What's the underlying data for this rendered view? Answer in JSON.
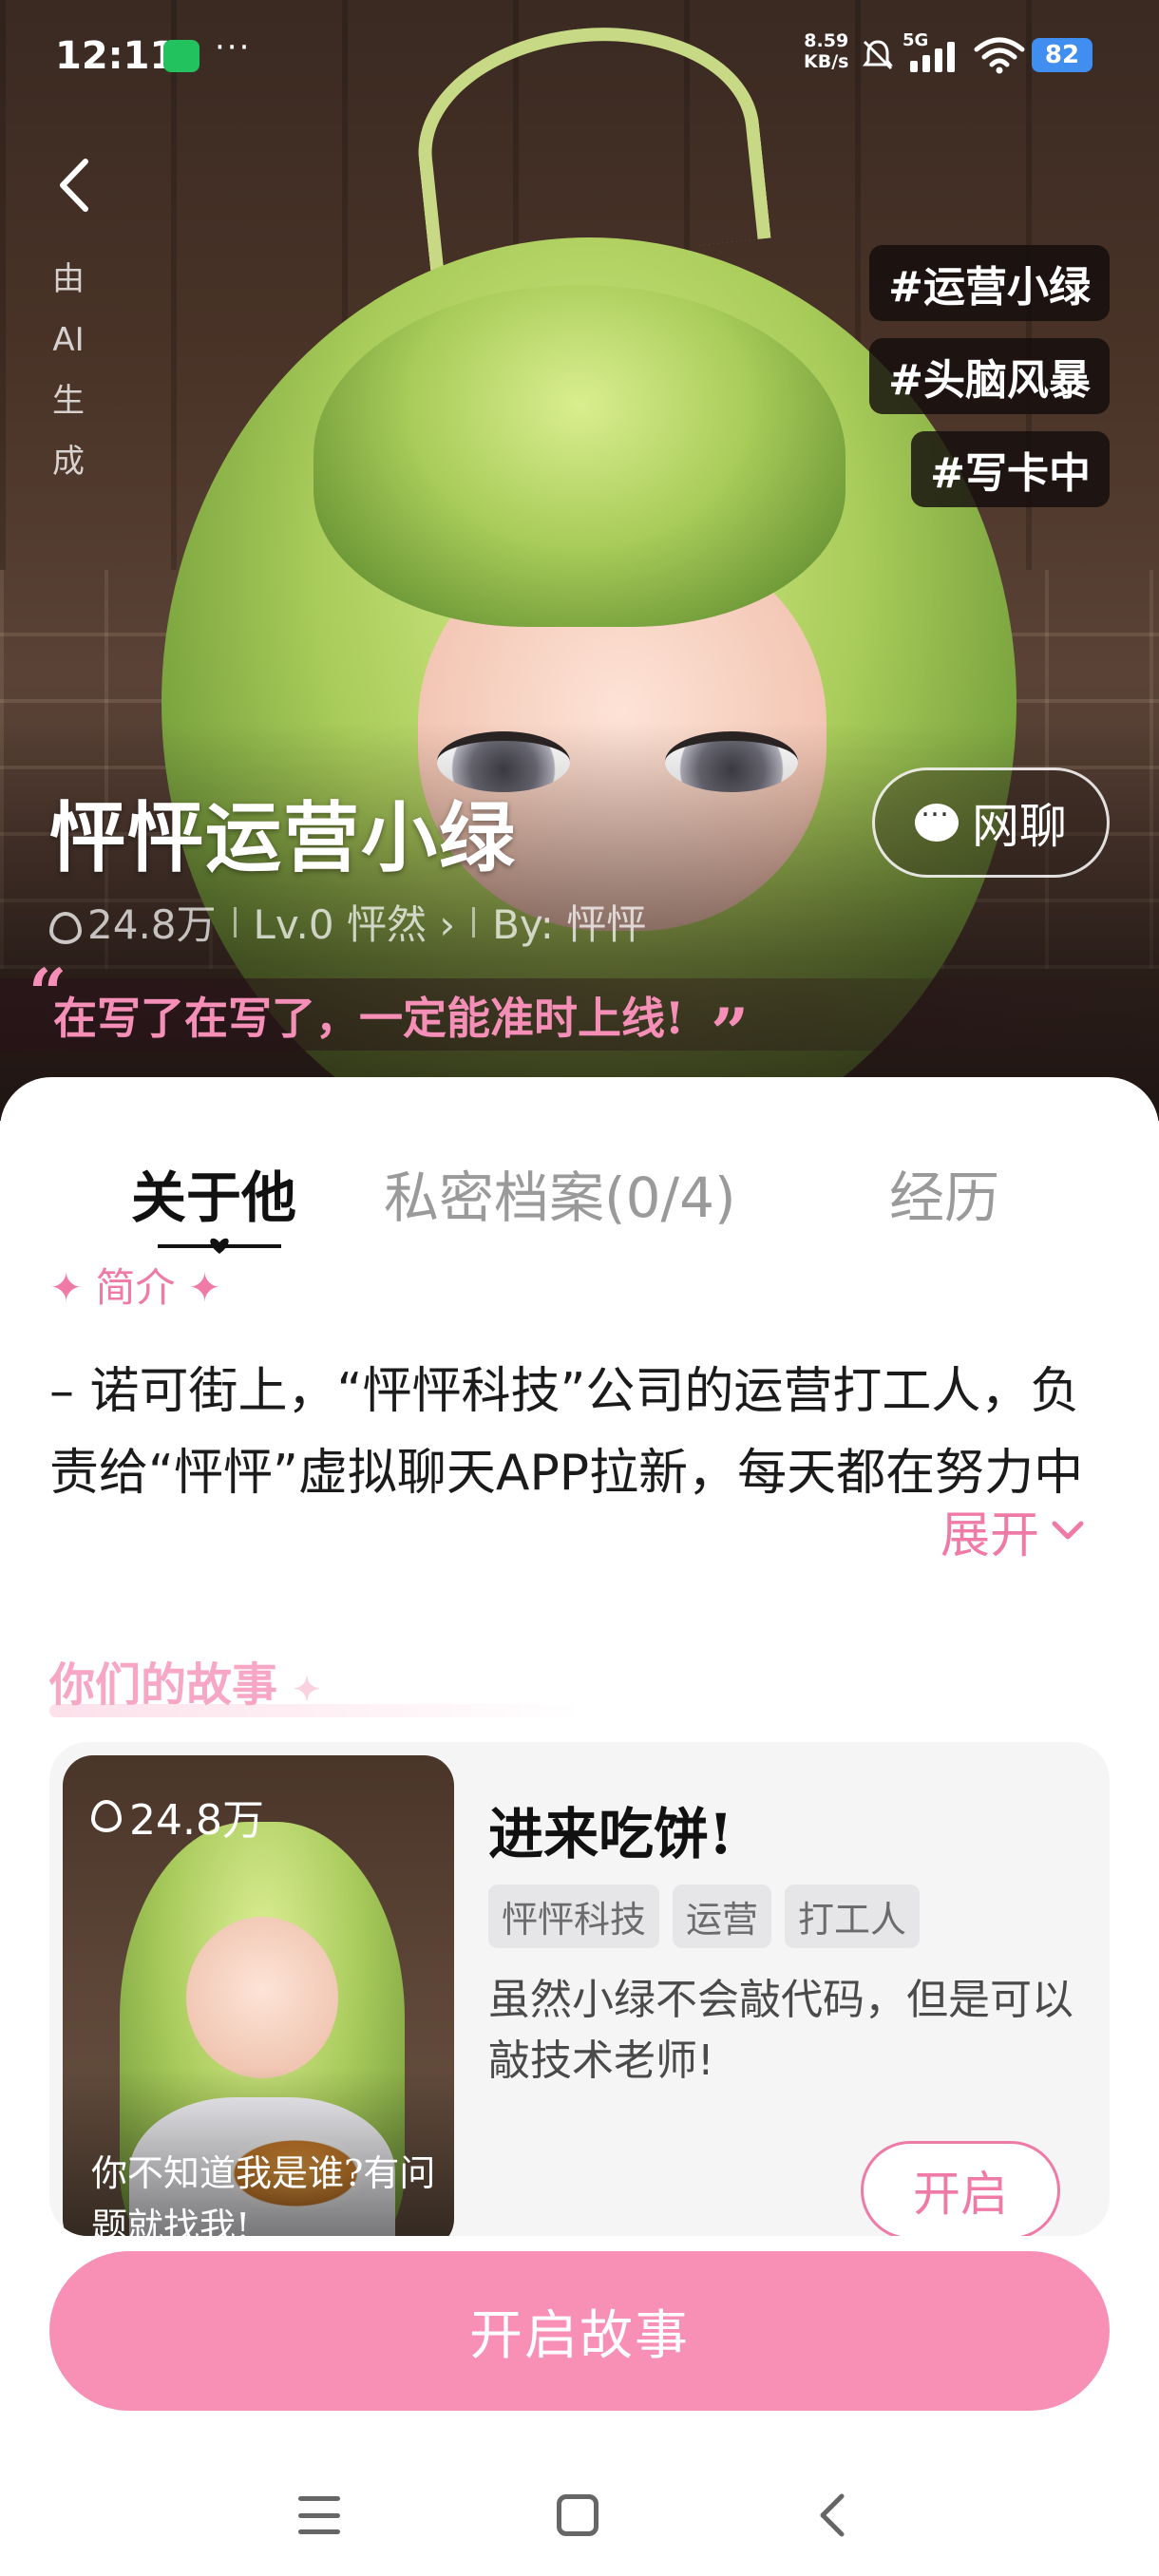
{
  "status_bar": {
    "time": "12:11",
    "more": "···",
    "net_speed_value": "8.59",
    "net_speed_unit": "KB/s",
    "network": "5G",
    "battery": "82"
  },
  "hero": {
    "ai_label": "由AI生成",
    "hashtags": [
      "#运营小绿",
      "#头脑风暴",
      "#写卡中"
    ],
    "name": "怦怦运营小绿",
    "chat_button": "网聊",
    "heat": "24.8万",
    "level": "Lv.0 怦然",
    "author": "By: 怦怦",
    "quote": "在写了在写了，一定能准时上线!"
  },
  "tabs": [
    "关于他",
    "私密档案(0/4)",
    "经历"
  ],
  "intro": {
    "title": "✦ 简介 ✦",
    "body": "– 诺可街上，“怦怦科技”公司的运营打工人，负责给“怦怦”虚拟聊天APP拉新，每天都在努力中",
    "expand": "展开"
  },
  "story": {
    "heading": "你们的故事",
    "card": {
      "heat": "24.8万",
      "caption": "你不知道我是谁?有问题就找我!",
      "title": "进来吃饼!",
      "tags": [
        "怦怦科技",
        "运营",
        "打工人"
      ],
      "description": "虽然小绿不会敲代码，但是可以敲技术老师!",
      "open_button": "开启"
    }
  },
  "primary_button": "开启故事",
  "colors": {
    "accent_pink": "#f07aa6",
    "cta_pink": "#f890b6",
    "battery_blue": "#3f8ef0"
  }
}
